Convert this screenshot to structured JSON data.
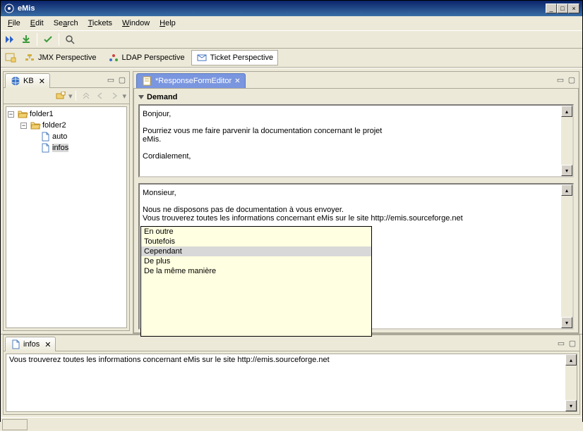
{
  "window": {
    "title": "eMis"
  },
  "menu": {
    "file": "File",
    "edit": "Edit",
    "search": "Search",
    "tickets": "Tickets",
    "window": "Window",
    "help": "Help"
  },
  "perspectives": {
    "jmx": "JMX Perspective",
    "ldap": "LDAP Perspective",
    "ticket": "Ticket Perspective"
  },
  "kb_view": {
    "title": "KB"
  },
  "tree": {
    "folder1": "folder1",
    "folder2": "folder2",
    "auto": "auto",
    "infos": "infos"
  },
  "editor": {
    "tab": "*ResponseFormEditor",
    "section": "Demand",
    "demand_text": "Bonjour,\n\nPourriez vous me faire parvenir la documentation concernant le projet\neMis.\n\nCordialement,",
    "response_text": "Monsieur,\n\nNous ne disposons pas de documentation à vous envoyer.\nVous trouverez toutes les informations concernant eMis sur le site http://emis.sourceforge.net"
  },
  "suggestions": {
    "s0": "En outre",
    "s1": "Toutefois",
    "s2": "Cependant",
    "s3": "De plus",
    "s4": "De la même manière"
  },
  "info_view": {
    "title": "infos",
    "text": "Vous trouverez toutes les informations concernant eMis sur le site http://emis.sourceforge.net"
  }
}
